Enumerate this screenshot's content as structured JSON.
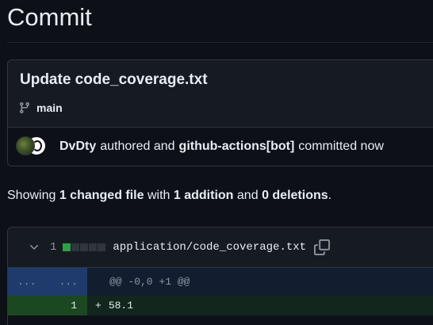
{
  "page": {
    "title": "Commit"
  },
  "commit": {
    "message": "Update code_coverage.txt",
    "branch": "main",
    "author": "DvDty",
    "authored_text": "authored and",
    "committer": "github-actions[bot]",
    "committed_text": "committed now"
  },
  "summary": {
    "prefix": "Showing",
    "changed": "1 changed file",
    "with_text": "with",
    "additions": "1 addition",
    "and_text": "and",
    "deletions": "0 deletions",
    "suffix": "."
  },
  "file": {
    "change_count": "1",
    "diffstat": [
      "add",
      "neutral",
      "neutral",
      "neutral",
      "neutral"
    ],
    "name": "application/code_coverage.txt",
    "hunk": {
      "left_marker": "...",
      "right_marker": "...",
      "header": "@@ -0,0 +1 @@"
    },
    "lines": [
      {
        "new_line_number": "1",
        "sign": "+",
        "content": "58.1"
      }
    ]
  },
  "colors": {
    "background": "#0d1117",
    "addition": "#2ea043",
    "hunk_gutter": "#1f3b6e",
    "add_gutter": "#1b4721"
  },
  "icons": {
    "branch": "git-branch-icon",
    "chevron": "chevron-down-icon",
    "copy": "copy-icon"
  }
}
